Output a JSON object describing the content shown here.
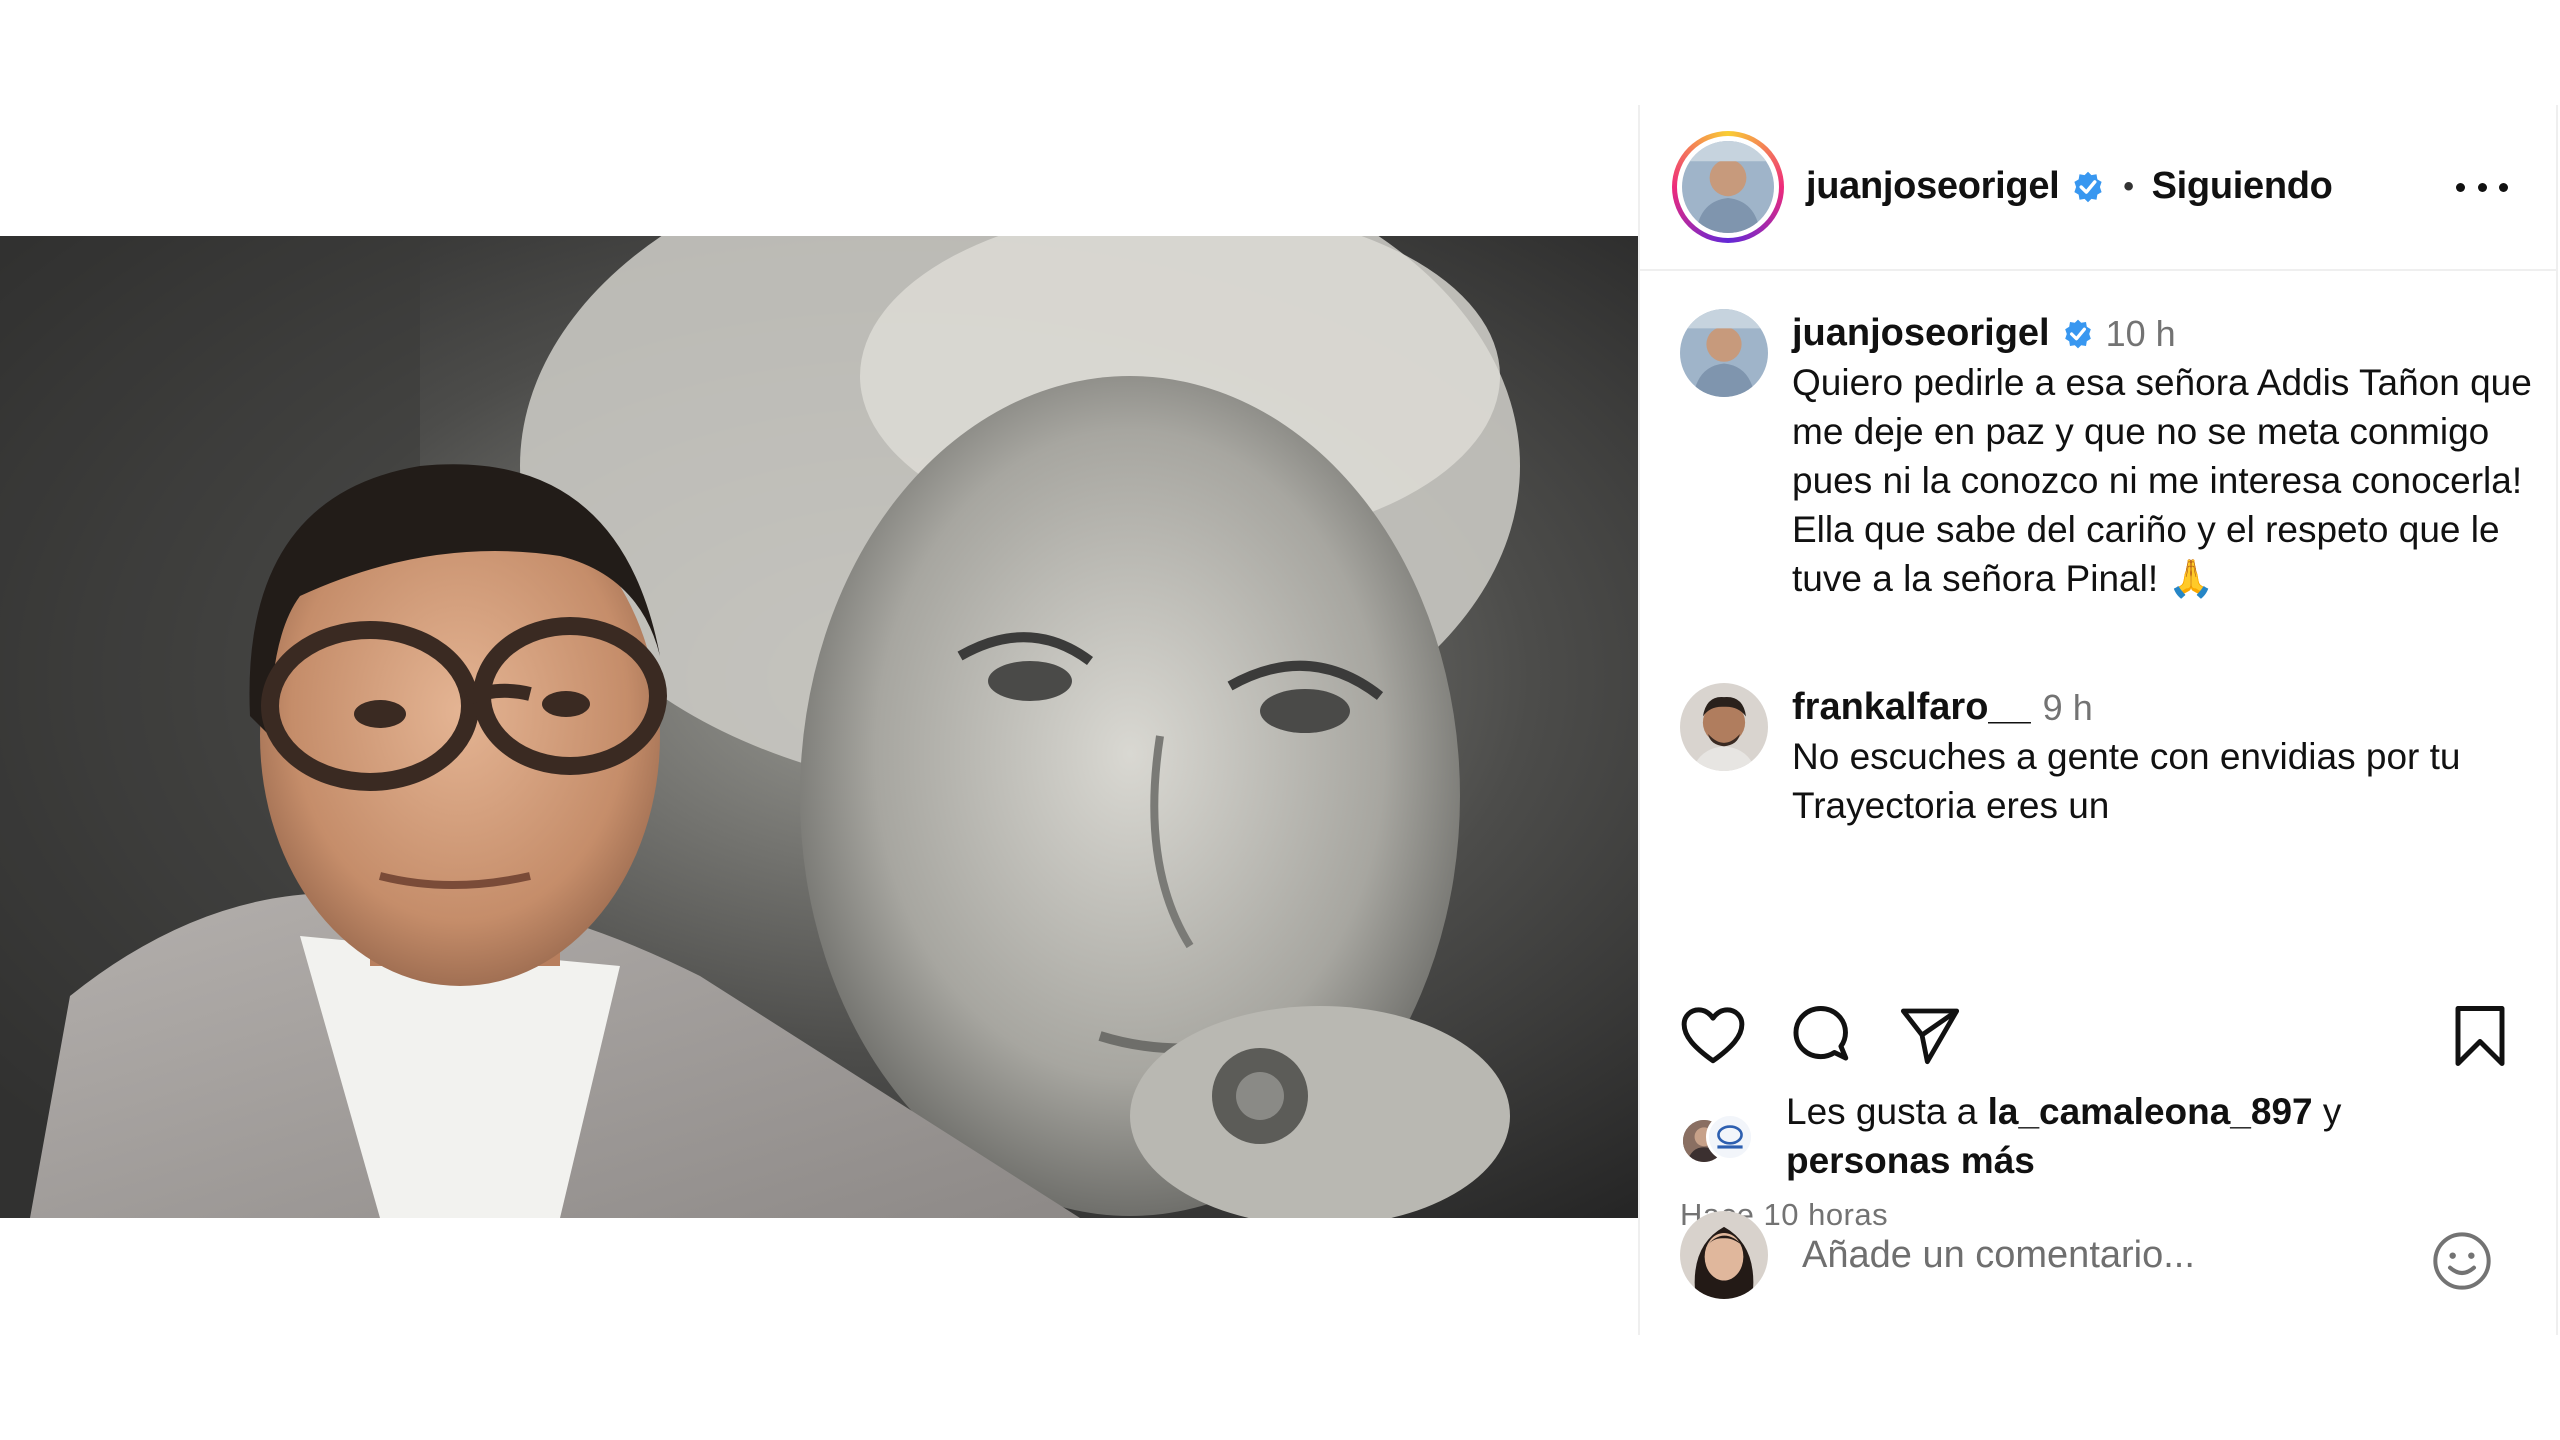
{
  "post": {
    "image_alt": "Post photo: man with glasses in front of black-and-white portrait of elderly woman"
  },
  "header": {
    "username": "juanjoseorigel",
    "separator": "•",
    "follow_status": "Siguiendo",
    "more_icon": "more-horizontal-icon"
  },
  "caption": {
    "username": "juanjoseorigel",
    "time": "10 h",
    "text": "Quiero pedirle a esa señora Addis Tañon que me deje en paz y que no se meta conmigo pues ni la conozco ni me interesa conocerla! Ella que sabe del cariño y el respeto que le tuve a la señora Pinal! 🙏"
  },
  "comments": [
    {
      "username": "frankalfaro__",
      "time": "9 h",
      "text": "No escuches a gente con envidias por tu Trayectoria eres un"
    }
  ],
  "actions": {
    "like_icon": "heart-icon",
    "comment_icon": "comment-icon",
    "share_icon": "send-icon",
    "save_icon": "bookmark-icon"
  },
  "likes": {
    "prefix": "Les gusta a ",
    "user": "la_camaleona_897",
    "middle": " y",
    "suffix": "personas más"
  },
  "timestamp": "Hace 10 horas",
  "add_comment": {
    "placeholder": "Añade un comentario...",
    "emoji_icon": "smile-icon"
  },
  "colors": {
    "verified": "#3897f0",
    "muted": "#737373",
    "border": "#efefef"
  }
}
